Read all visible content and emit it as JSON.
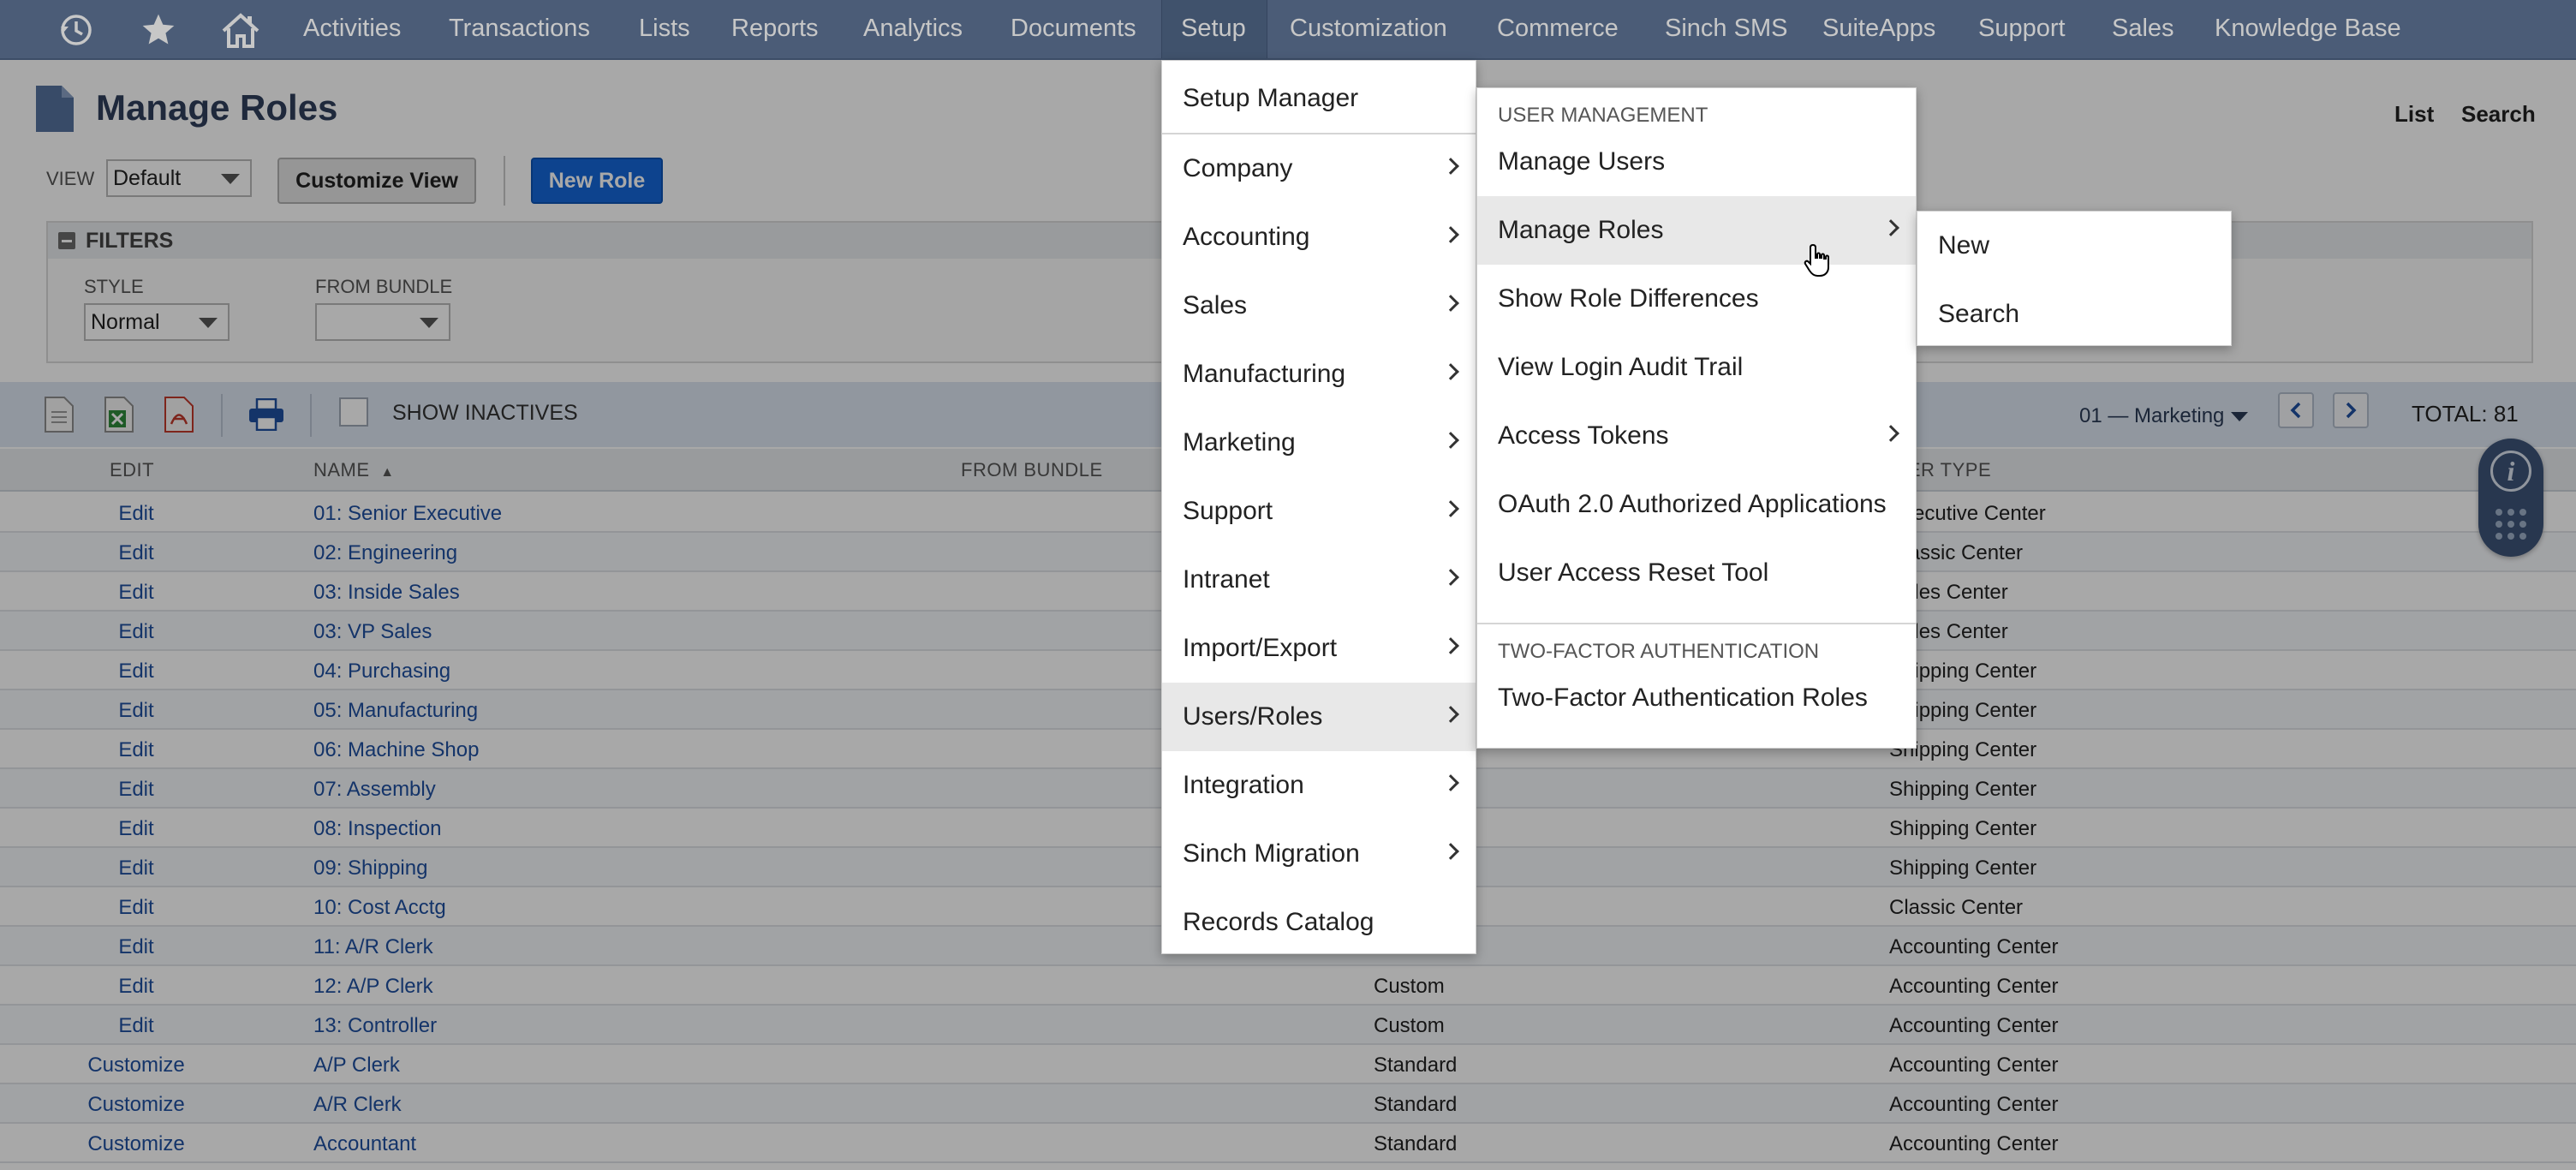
{
  "nav": {
    "items": [
      {
        "label": "Activities"
      },
      {
        "label": "Transactions"
      },
      {
        "label": "Lists"
      },
      {
        "label": "Reports"
      },
      {
        "label": "Analytics"
      },
      {
        "label": "Documents"
      },
      {
        "label": "Setup"
      },
      {
        "label": "Customization"
      },
      {
        "label": "Commerce"
      },
      {
        "label": "Sinch SMS"
      },
      {
        "label": "SuiteApps"
      },
      {
        "label": "Support"
      },
      {
        "label": "Sales"
      },
      {
        "label": "Knowledge Base"
      }
    ],
    "active": "Setup",
    "icons": [
      "recent-history-icon",
      "star-icon",
      "home-icon"
    ]
  },
  "page": {
    "title": "Manage Roles",
    "links": {
      "list": "List",
      "search": "Search"
    },
    "view_label": "VIEW",
    "view_value": "Default",
    "customize_view": "Customize View",
    "new_role": "New Role"
  },
  "filters": {
    "title": "FILTERS",
    "style_label": "STYLE",
    "style_value": "Normal",
    "bundle_label": "FROM BUNDLE",
    "bundle_value": ""
  },
  "toolbar": {
    "show_inactives": "SHOW INACTIVES",
    "pager_value": "01 — Marketing",
    "total": "TOTAL: 81",
    "icons": [
      "export-csv-icon",
      "export-excel-icon",
      "export-pdf-icon",
      "print-icon"
    ]
  },
  "table": {
    "headers": {
      "edit": "EDIT",
      "name": "NAME",
      "from_bundle": "FROM BUNDLE",
      "center_type": "CENTER TYPE"
    },
    "sort_indicator": "▲",
    "rows": [
      {
        "edit": "Edit",
        "name": "01: Senior Executive",
        "type": "",
        "center": "Executive Center"
      },
      {
        "edit": "Edit",
        "name": "02: Engineering",
        "type": "",
        "center": "Classic Center"
      },
      {
        "edit": "Edit",
        "name": "03: Inside Sales",
        "type": "",
        "center": "Sales Center"
      },
      {
        "edit": "Edit",
        "name": "03: VP Sales",
        "type": "",
        "center": "Sales Center"
      },
      {
        "edit": "Edit",
        "name": "04: Purchasing",
        "type": "",
        "center": "Shipping Center"
      },
      {
        "edit": "Edit",
        "name": "05: Manufacturing",
        "type": "",
        "center": "Shipping Center"
      },
      {
        "edit": "Edit",
        "name": "06: Machine Shop",
        "type": "",
        "center": "Shipping Center"
      },
      {
        "edit": "Edit",
        "name": "07: Assembly",
        "type": "",
        "center": "Shipping Center"
      },
      {
        "edit": "Edit",
        "name": "08: Inspection",
        "type": "",
        "center": "Shipping Center"
      },
      {
        "edit": "Edit",
        "name": "09: Shipping",
        "type": "",
        "center": "Shipping Center"
      },
      {
        "edit": "Edit",
        "name": "10: Cost Acctg",
        "type": "",
        "center": "Classic Center"
      },
      {
        "edit": "Edit",
        "name": "11: A/R Clerk",
        "type": "",
        "center": "Accounting Center"
      },
      {
        "edit": "Edit",
        "name": "12: A/P Clerk",
        "type": "Custom",
        "center": "Accounting Center"
      },
      {
        "edit": "Edit",
        "name": "13: Controller",
        "type": "Custom",
        "center": "Accounting Center"
      },
      {
        "edit": "Customize",
        "name": "A/P Clerk",
        "type": "Standard",
        "center": "Accounting Center"
      },
      {
        "edit": "Customize",
        "name": "A/R Clerk",
        "type": "Standard",
        "center": "Accounting Center"
      },
      {
        "edit": "Customize",
        "name": "Accountant",
        "type": "Standard",
        "center": "Accounting Center"
      }
    ]
  },
  "setup_menu": {
    "items": [
      {
        "label": "Setup Manager",
        "submenu": false
      },
      {
        "label": "Company",
        "submenu": true
      },
      {
        "label": "Accounting",
        "submenu": true
      },
      {
        "label": "Sales",
        "submenu": true
      },
      {
        "label": "Manufacturing",
        "submenu": true
      },
      {
        "label": "Marketing",
        "submenu": true
      },
      {
        "label": "Support",
        "submenu": true
      },
      {
        "label": "Intranet",
        "submenu": true
      },
      {
        "label": "Import/Export",
        "submenu": true
      },
      {
        "label": "Users/Roles",
        "submenu": true
      },
      {
        "label": "Integration",
        "submenu": true
      },
      {
        "label": "Sinch Migration",
        "submenu": true
      },
      {
        "label": "Records Catalog",
        "submenu": false
      }
    ],
    "highlighted": "Users/Roles"
  },
  "users_roles_menu": {
    "header_user_mgmt": "USER MANAGEMENT",
    "items_user_mgmt": [
      {
        "label": "Manage Users",
        "submenu": false
      },
      {
        "label": "Manage Roles",
        "submenu": true
      },
      {
        "label": "Show Role Differences",
        "submenu": false
      },
      {
        "label": "View Login Audit Trail",
        "submenu": false
      },
      {
        "label": "Access Tokens",
        "submenu": true
      },
      {
        "label": "OAuth 2.0 Authorized Applications",
        "submenu": false
      },
      {
        "label": "User Access Reset Tool",
        "submenu": false
      }
    ],
    "header_2fa": "TWO-FACTOR AUTHENTICATION",
    "items_2fa": [
      {
        "label": "Two-Factor Authentication Roles",
        "submenu": false
      }
    ],
    "highlighted": "Manage Roles"
  },
  "manage_roles_menu": {
    "items": [
      {
        "label": "New"
      },
      {
        "label": "Search"
      }
    ]
  },
  "colors": {
    "nav_bg": "#607799",
    "primary_button": "#1466d8",
    "link": "#1f4fa0"
  }
}
